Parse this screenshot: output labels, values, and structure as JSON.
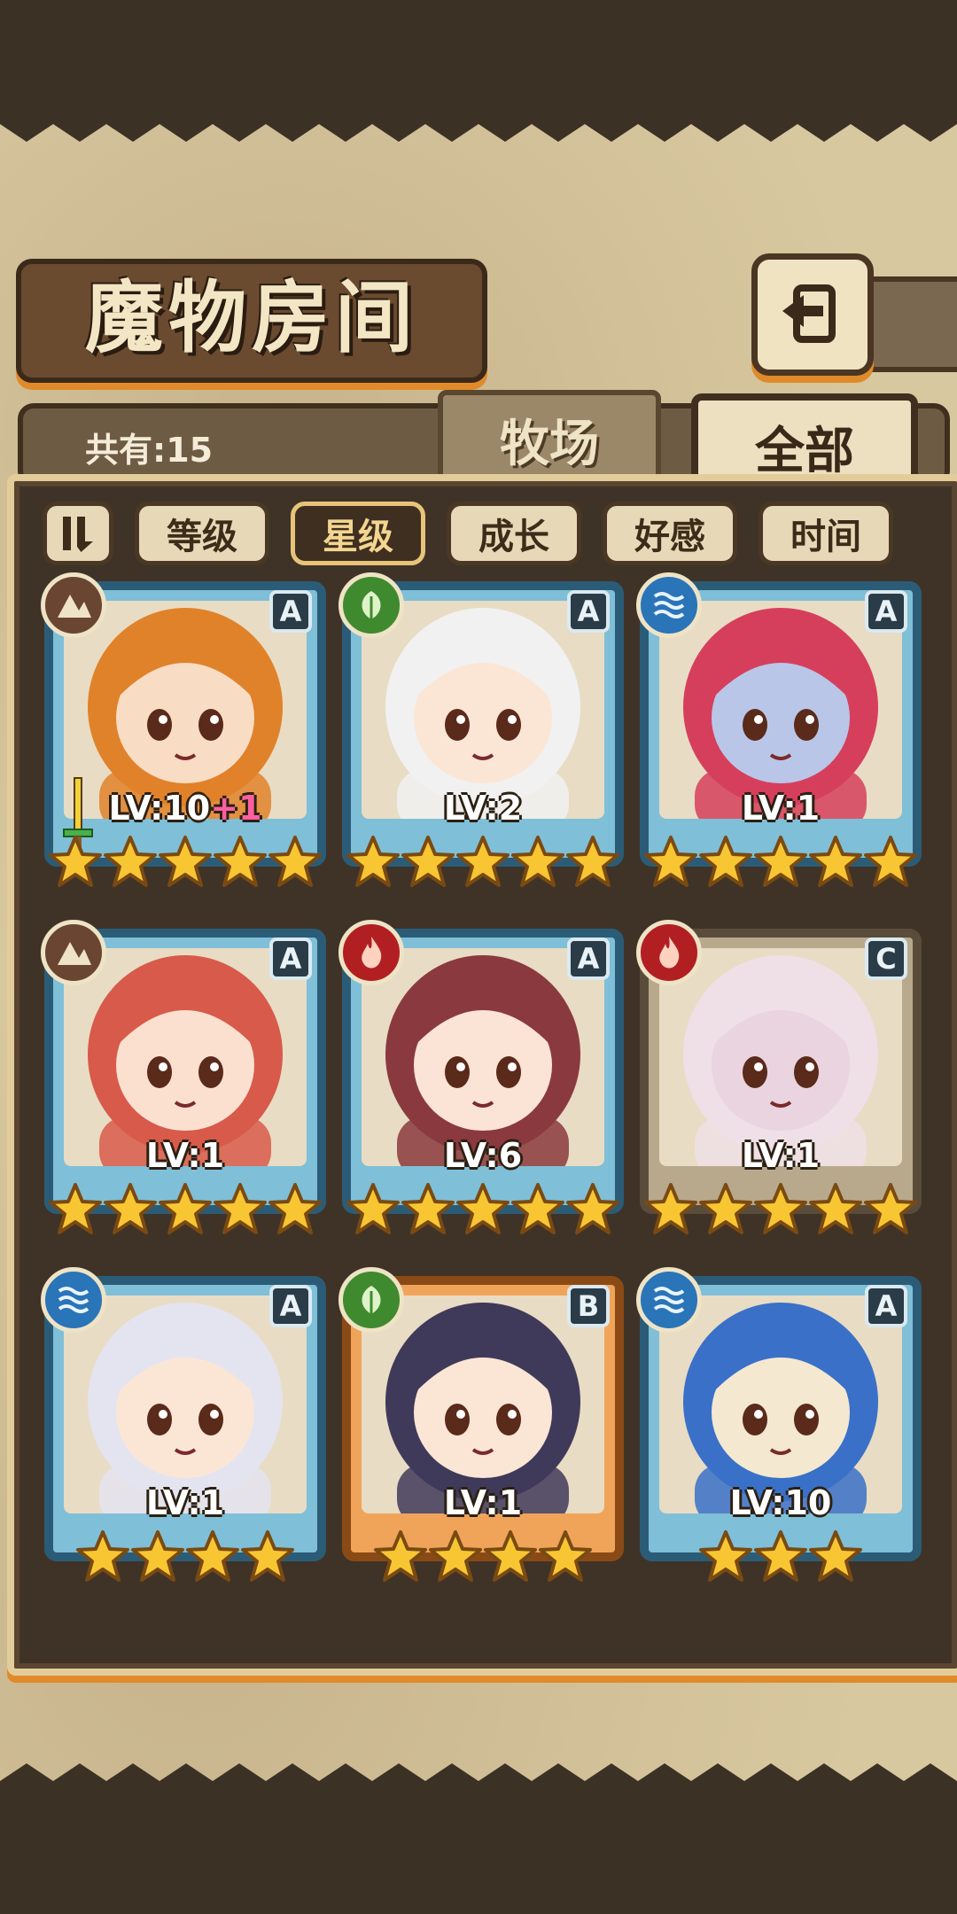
{
  "header": {
    "title": "魔物房间",
    "back_icon": "return-arrow-icon"
  },
  "summary": {
    "count_label": "共有:15"
  },
  "tabs": [
    {
      "label": "牧场",
      "active": false
    },
    {
      "label": "全部",
      "active": true
    }
  ],
  "filters": [
    {
      "label": "等级",
      "active": false
    },
    {
      "label": "星级",
      "active": true
    },
    {
      "label": "成长",
      "active": false
    },
    {
      "label": "好感",
      "active": false
    },
    {
      "label": "时间",
      "active": false
    }
  ],
  "colors": {
    "accent_orange": "#e08a2a",
    "frame_blue": "#2b5c77",
    "star_gold": "#f7c632"
  },
  "monsters": [
    {
      "element": "earth",
      "rank": "A",
      "level": "LV:10",
      "bonus": "+1",
      "stars": 5,
      "frame": "blue",
      "equip": "sword-icon",
      "hair": "#e0822a",
      "skin": "#f8dcc4"
    },
    {
      "element": "wind",
      "rank": "A",
      "level": "LV:2",
      "bonus": "",
      "stars": 5,
      "frame": "blue",
      "hair": "#f1f1f1",
      "skin": "#fbe6d6"
    },
    {
      "element": "water",
      "rank": "A",
      "level": "LV:1",
      "bonus": "",
      "stars": 5,
      "frame": "blue",
      "hair": "#d63f5c",
      "skin": "#b9c6e8"
    },
    {
      "element": "earth",
      "rank": "A",
      "level": "LV:1",
      "bonus": "",
      "stars": 5,
      "frame": "blue",
      "hair": "#d85a4a",
      "skin": "#fbe0d0"
    },
    {
      "element": "fire",
      "rank": "A",
      "level": "LV:6",
      "bonus": "",
      "stars": 5,
      "frame": "blue",
      "hair": "#8a3a3e",
      "skin": "#fbe3d6"
    },
    {
      "element": "fire",
      "rank": "C",
      "level": "LV:1",
      "bonus": "",
      "stars": 5,
      "frame": "tan",
      "hair": "#efdfe6",
      "skin": "#e9d4e0"
    },
    {
      "element": "water",
      "rank": "A",
      "level": "LV:1",
      "bonus": "",
      "stars": 4,
      "frame": "blue",
      "hair": "#e4e4f0",
      "skin": "#fbe6d6"
    },
    {
      "element": "wind",
      "rank": "B",
      "level": "LV:1",
      "bonus": "",
      "stars": 4,
      "frame": "orange",
      "hair": "#3f3a5a",
      "skin": "#fbe6d6"
    },
    {
      "element": "water",
      "rank": "A",
      "level": "LV:10",
      "bonus": "",
      "stars": 3,
      "frame": "blue",
      "hair": "#3a70c8",
      "skin": "#f4e8d0"
    }
  ]
}
